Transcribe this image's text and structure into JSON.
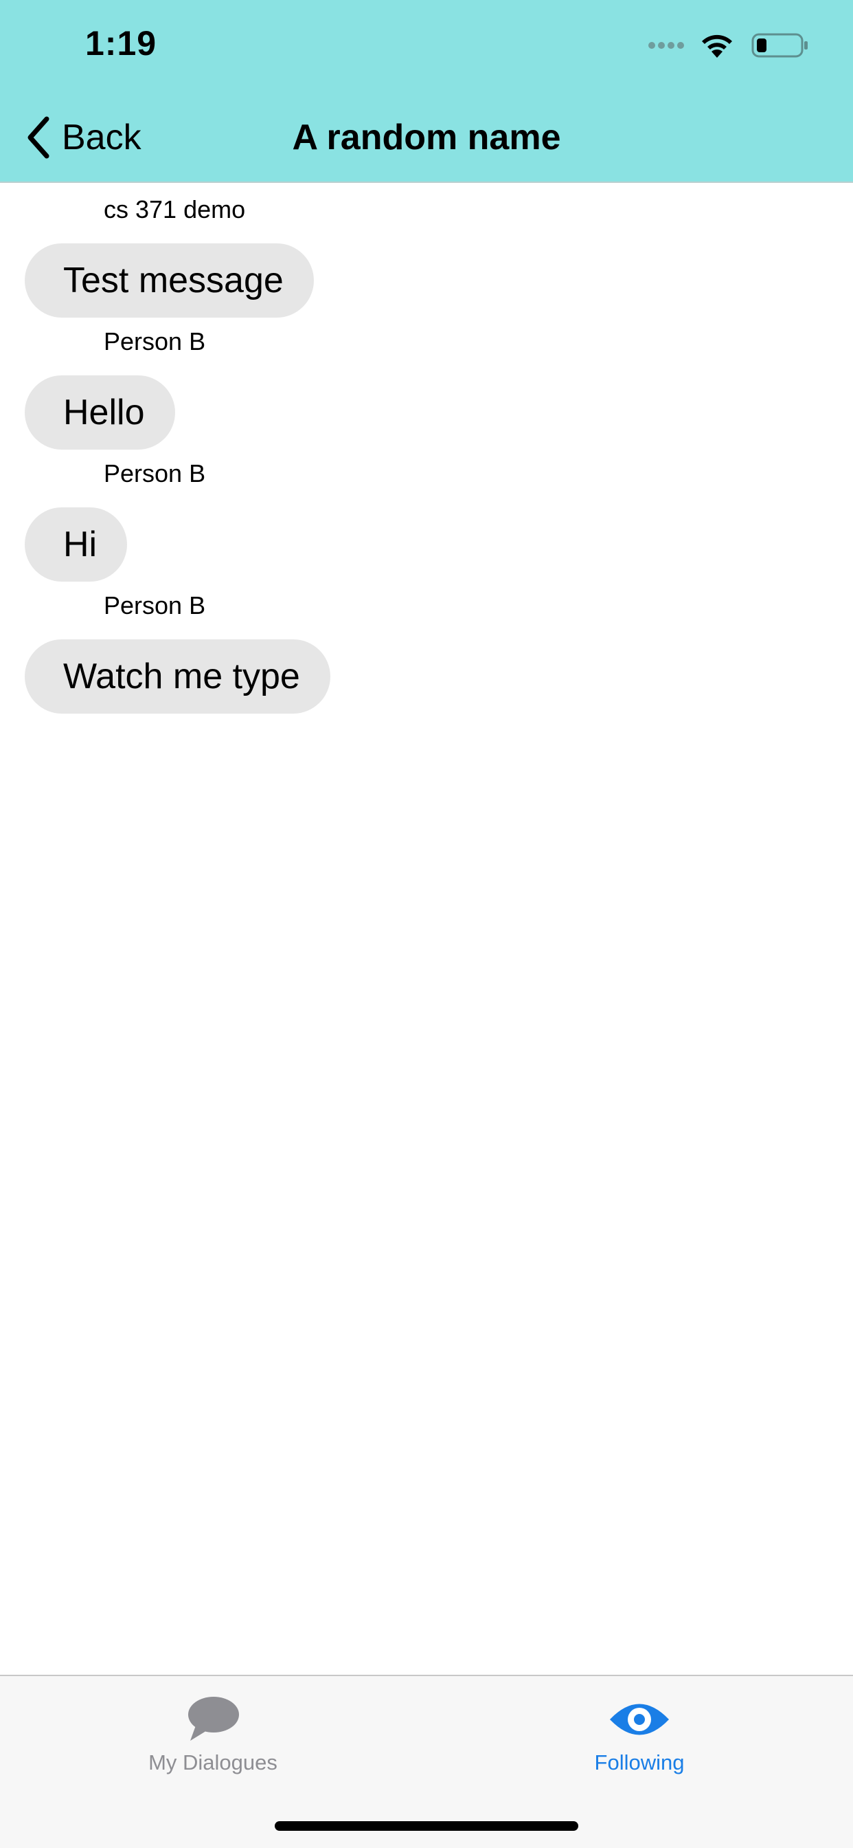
{
  "status_bar": {
    "time": "1:19"
  },
  "nav": {
    "back_label": "Back",
    "title": "A random name"
  },
  "messages": [
    {
      "sender": "cs 371 demo",
      "text": "Test message"
    },
    {
      "sender": "Person B",
      "text": "Hello"
    },
    {
      "sender": "Person B",
      "text": "Hi"
    },
    {
      "sender": "Person B",
      "text": "Watch me type"
    }
  ],
  "tab_bar": {
    "tabs": [
      {
        "label": "My Dialogues",
        "icon": "speech-bubble-icon",
        "selected": false
      },
      {
        "label": "Following",
        "icon": "eye-icon",
        "selected": true
      }
    ]
  },
  "colors": {
    "header_background": "#8ae2e2",
    "bubble_background": "#e6e6e6",
    "tab_active": "#1a7ee6",
    "tab_inactive": "#8e8e93"
  }
}
